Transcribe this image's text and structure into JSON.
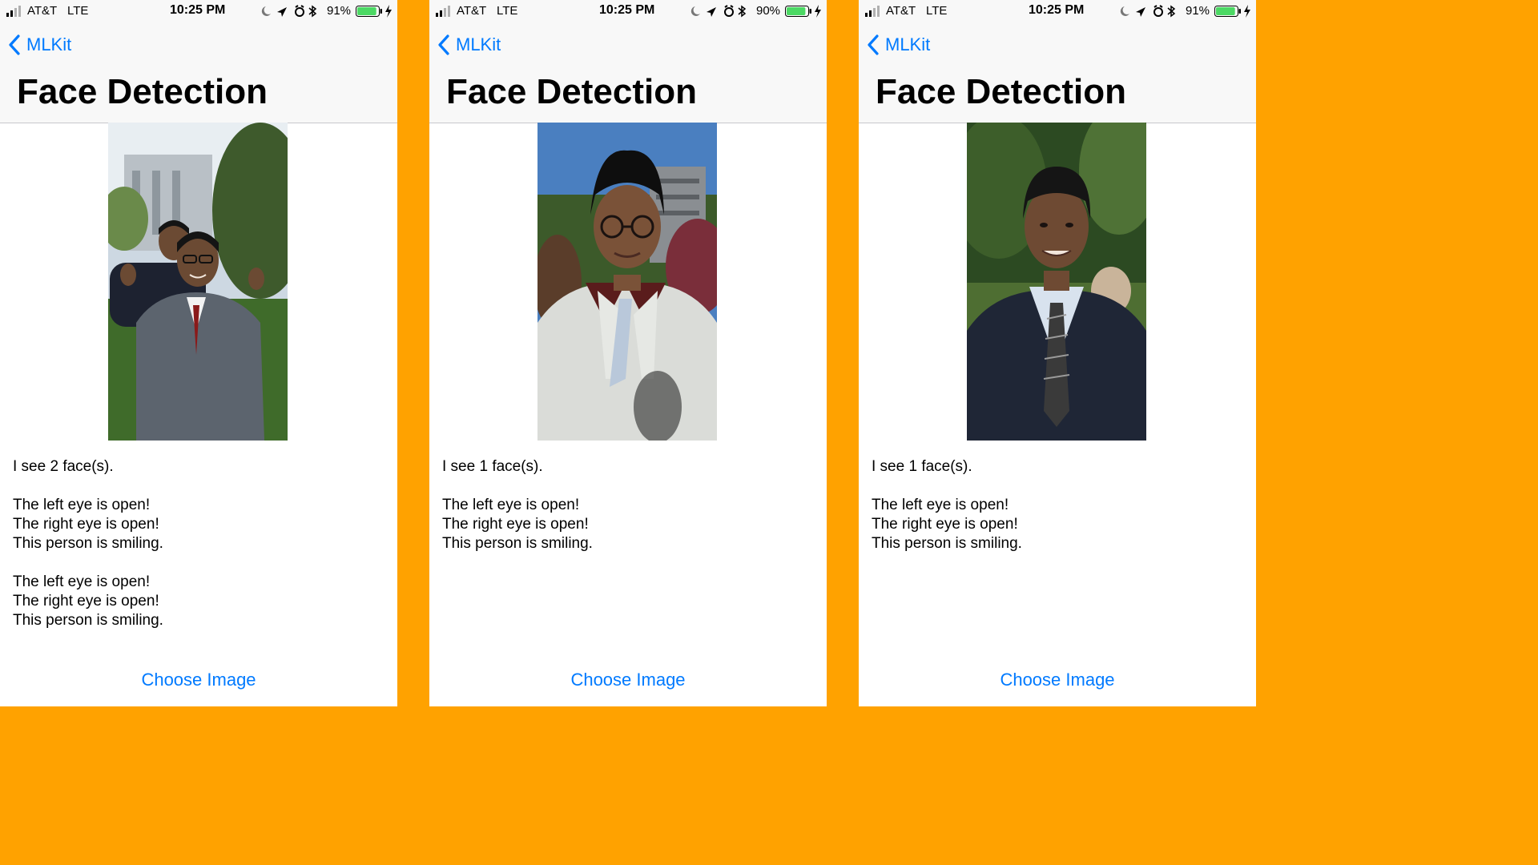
{
  "colors": {
    "accent": "#007aff",
    "divider": "#FFA200",
    "battery": "#4cd964"
  },
  "screens": [
    {
      "status": {
        "carrier": "AT&T",
        "network": "LTE",
        "time": "10:25 PM",
        "battery_pct": "91%",
        "battery_level": 0.91
      },
      "nav": {
        "back_label": "MLKit",
        "title": "Face Detection"
      },
      "photo": {
        "icon": "photo-two-people"
      },
      "results": {
        "count_text": "I see 2 face(s).",
        "faces": [
          {
            "left_eye": "The left eye is open!",
            "right_eye": "The right eye is open!",
            "smile": "This person is smiling."
          },
          {
            "left_eye": "The left eye is open!",
            "right_eye": "The right eye is open!",
            "smile": "This person is smiling."
          }
        ]
      },
      "choose_label": "Choose Image"
    },
    {
      "status": {
        "carrier": "AT&T",
        "network": "LTE",
        "time": "10:25 PM",
        "battery_pct": "90%",
        "battery_level": 0.9
      },
      "nav": {
        "back_label": "MLKit",
        "title": "Face Detection"
      },
      "photo": {
        "icon": "photo-person-light-suit"
      },
      "results": {
        "count_text": "I see 1 face(s).",
        "faces": [
          {
            "left_eye": "The left eye is open!",
            "right_eye": "The right eye is open!",
            "smile": "This person is smiling."
          }
        ]
      },
      "choose_label": "Choose Image"
    },
    {
      "status": {
        "carrier": "AT&T",
        "network": "LTE",
        "time": "10:25 PM",
        "battery_pct": "91%",
        "battery_level": 0.91
      },
      "nav": {
        "back_label": "MLKit",
        "title": "Face Detection"
      },
      "photo": {
        "icon": "photo-person-dark-suit"
      },
      "results": {
        "count_text": "I see 1 face(s).",
        "faces": [
          {
            "left_eye": "The left eye is open!",
            "right_eye": "The right eye is open!",
            "smile": "This person is smiling."
          }
        ]
      },
      "choose_label": "Choose Image"
    }
  ]
}
